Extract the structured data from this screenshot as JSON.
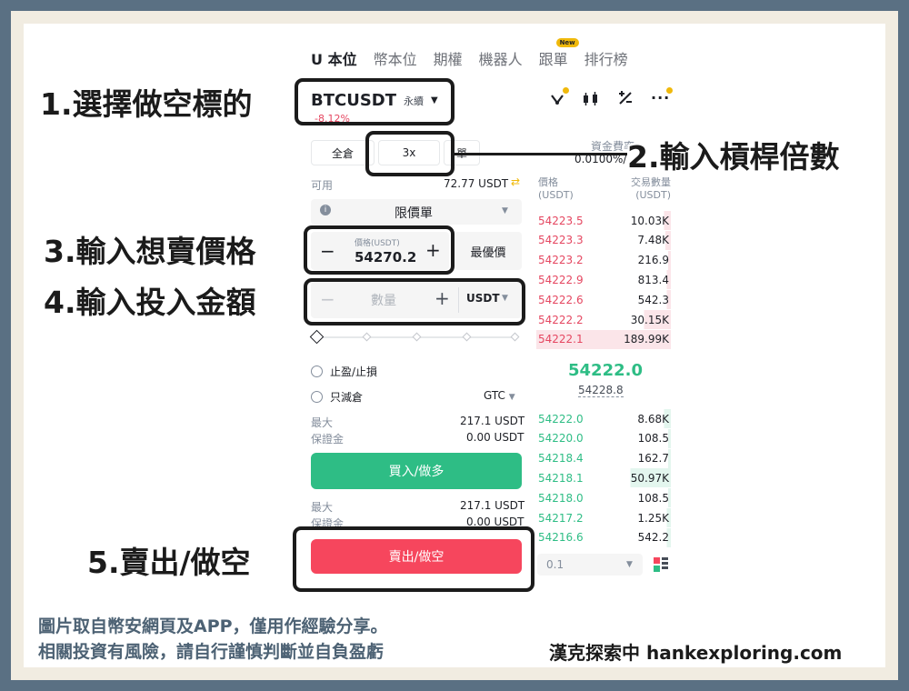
{
  "tabs": [
    {
      "label": "U 本位",
      "active": true
    },
    {
      "label": "幣本位",
      "active": false
    },
    {
      "label": "期權",
      "active": false
    },
    {
      "label": "機器人",
      "active": false
    },
    {
      "label": "跟單",
      "active": false,
      "badge": "New"
    },
    {
      "label": "排行榜",
      "active": false
    }
  ],
  "pair": {
    "symbol": "BTCUSDT",
    "type": "永續",
    "change": "-8.12%"
  },
  "toolbar": {
    "icons": [
      "trade-icon",
      "candlestick-icon",
      "percent-icon",
      "more-icon"
    ],
    "accent": "#f0b90b"
  },
  "margin": {
    "mode": "全倉",
    "leverage": "3x",
    "side_label": "單"
  },
  "funding": {
    "label": "資金費率",
    "value": "0.0100%/"
  },
  "available": {
    "label": "可用",
    "value": "72.77 USDT"
  },
  "order_type": {
    "value": "限價單"
  },
  "price_field": {
    "label": "價格(USDT)",
    "value": "54270.2",
    "minus": "−",
    "plus": "+"
  },
  "best_price": "最優價",
  "amount_field": {
    "placeholder": "數量",
    "unit": "USDT",
    "minus": "−",
    "plus": "+"
  },
  "options": {
    "tp_sl": "止盈/止損",
    "reduce_only": "只減倉",
    "tif": "GTC"
  },
  "buy_info": {
    "max_label": "最大",
    "max_value": "217.1 USDT",
    "margin_label": "保證金",
    "margin_value": "0.00 USDT"
  },
  "buy_button": "買入/做多",
  "sell_info": {
    "max_label": "最大",
    "max_value": "217.1 USDT",
    "margin_label": "保證金",
    "margin_value": "0.00 USDT"
  },
  "sell_button": "賣出/做空",
  "orderbook": {
    "price_header": "價格",
    "price_unit": "(USDT)",
    "qty_header": "交易數量",
    "qty_unit": "(USDT)",
    "asks": [
      {
        "price": "54223.5",
        "qty": "10.03K",
        "depth": 0.05
      },
      {
        "price": "54223.3",
        "qty": "7.48K",
        "depth": 0.04
      },
      {
        "price": "54223.2",
        "qty": "216.9",
        "depth": 0.02
      },
      {
        "price": "54222.9",
        "qty": "813.4",
        "depth": 0.03
      },
      {
        "price": "54222.6",
        "qty": "542.3",
        "depth": 0.03
      },
      {
        "price": "54222.2",
        "qty": "30.15K",
        "depth": 0.2
      },
      {
        "price": "54222.1",
        "qty": "189.99K",
        "depth": 1.0
      }
    ],
    "last_price": "54222.0",
    "mark_price": "54228.8",
    "bids": [
      {
        "price": "54222.0",
        "qty": "8.68K",
        "depth": 0.05
      },
      {
        "price": "54220.0",
        "qty": "108.5",
        "depth": 0.02
      },
      {
        "price": "54218.4",
        "qty": "162.7",
        "depth": 0.02
      },
      {
        "price": "54218.1",
        "qty": "50.97K",
        "depth": 0.3
      },
      {
        "price": "54218.0",
        "qty": "108.5",
        "depth": 0.02
      },
      {
        "price": "54217.2",
        "qty": "1.25K",
        "depth": 0.03
      },
      {
        "price": "54216.6",
        "qty": "542.2",
        "depth": 0.03
      }
    ],
    "precision": "0.1"
  },
  "annotations": {
    "step1": "1.選擇做空標的",
    "step2": "2.輸入槓桿倍數",
    "step3": "3.輸入想賣價格",
    "step4": "4.輸入投入金額",
    "step5": "5.賣出/做空"
  },
  "footer": {
    "line1": "圖片取自幣安網頁及APP，僅用作經驗分享。",
    "line2": "相關投資有風險，請自行謹慎判斷並自負盈虧",
    "brand": "漢克探索中 hankexploring.com"
  },
  "colors": {
    "ask": "#e54761",
    "bid": "#2ebd85",
    "sell_button": "#f6465d",
    "buy_button": "#2ebd85",
    "border": "#5a7083"
  }
}
